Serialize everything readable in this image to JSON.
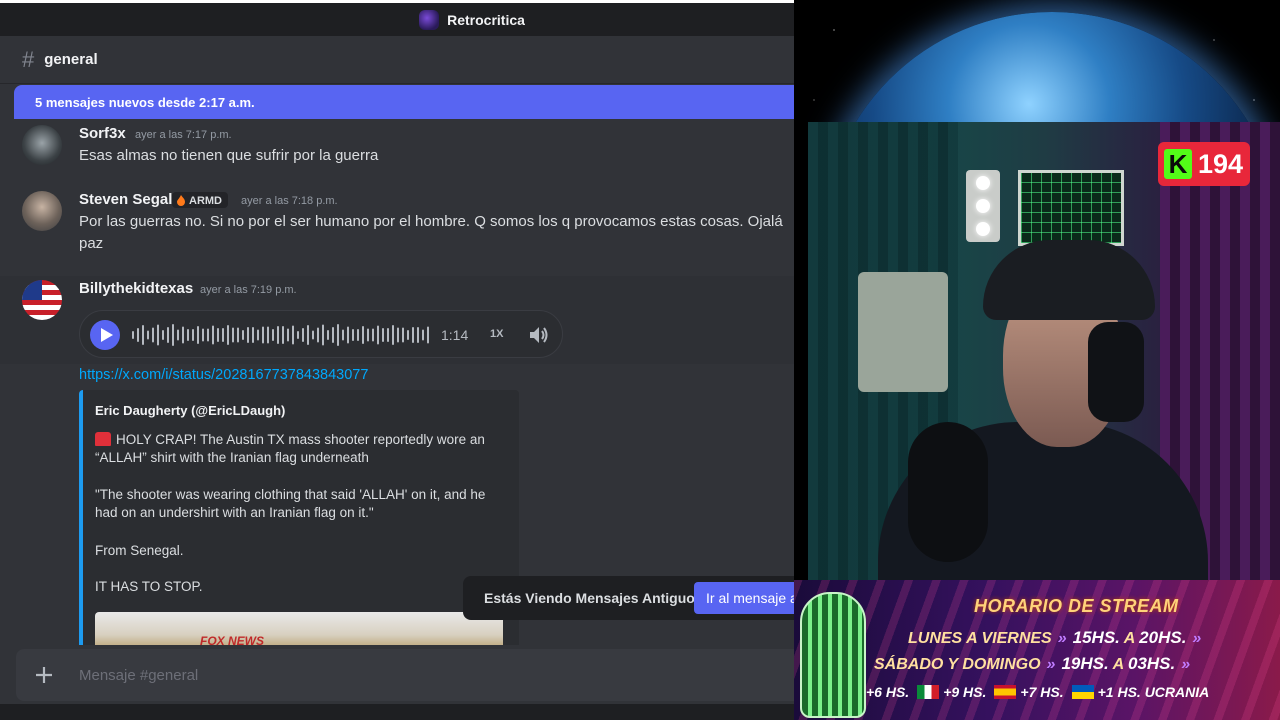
{
  "window": {
    "server_name": "Retrocritica"
  },
  "channel": {
    "name": "general",
    "hash": "#"
  },
  "new_messages_banner": "5 mensajes nuevos desde 2:17 a.m.",
  "messages": [
    {
      "author": "Sorf3x",
      "timestamp": "ayer a las 7:17 p.m.",
      "lines": [
        "Esas almas no tienen que sufrir por la guerra"
      ]
    },
    {
      "author": "Steven Segal",
      "badge": "ARMD",
      "timestamp": "ayer a las 7:18 p.m.",
      "lines": [
        "Por las guerras no. Si no por el ser humano por el hombre. Q somos los q provocamos estas cosas. Ojalá",
        "paz"
      ]
    },
    {
      "author": "Billythekidtexas",
      "timestamp": "ayer a las 7:19 p.m.",
      "voice": {
        "duration": "1:14",
        "speed": "1X"
      },
      "link": "https://x.com/i/status/2028167737843843077",
      "embed": {
        "author": "Eric Daugherty (@EricLDaugh)",
        "paragraphs": [
          "HOLY CRAP! The Austin TX mass shooter reportedly wore an",
          "“ALLAH” shirt with the Iranian flag underneath",
          "\"The shooter was wearing clothing that said 'ALLAH' on it, and he",
          "had on an undershirt with an Iranian flag on it.\"",
          "From Senegal.",
          "IT HAS TO STOP."
        ],
        "image_caption": "FOX NEWS"
      }
    }
  ],
  "jump_bar": {
    "text": "Estás Viendo Mensajes Antiguos",
    "button": "Ir al mensaje a"
  },
  "composer": {
    "placeholder": "Mensaje #general"
  },
  "icons": {
    "hash": "hash-icon",
    "play": "play-icon",
    "volume": "speaker-icon",
    "plus": "plus-icon",
    "kick": "kick-logo-icon"
  },
  "colors": {
    "blurple": "#5865f2",
    "link": "#00a8fc",
    "embed_border": "#1d9bf0",
    "kick_green": "#53fc18",
    "badge_red": "#e8273a"
  },
  "stream": {
    "viewer_count": "194",
    "schedule": {
      "title": "HORARIO DE STREAM",
      "rows": [
        {
          "days": "LUNES A VIERNES",
          "from": "15HS.",
          "sep": "A",
          "to": "20HS."
        },
        {
          "days": "SÁBADO Y DOMINGO",
          "from": "19HS.",
          "sep": "A",
          "to": "03HS."
        }
      ],
      "timezones": [
        "+6 HS.",
        "+9 HS.",
        "+7 HS.",
        "+1 HS. UCRANIA"
      ]
    }
  }
}
